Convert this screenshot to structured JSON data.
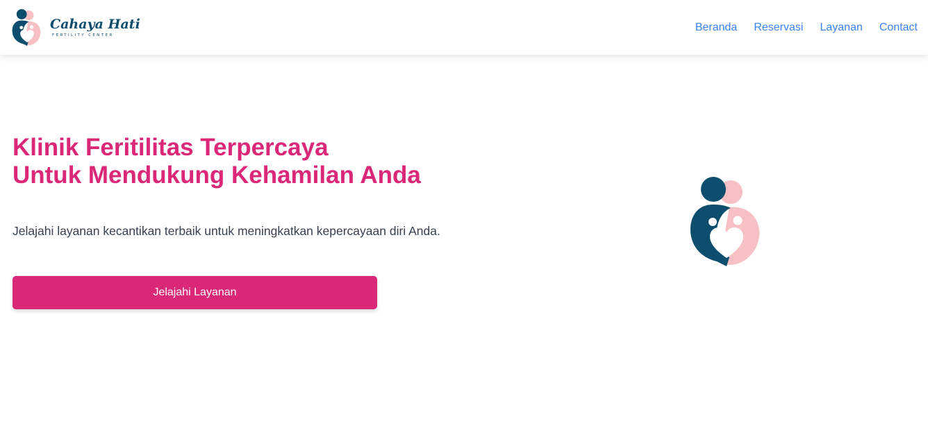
{
  "brand": {
    "name": "Cahaya Hati",
    "subtitle": "FERTILITY CENTER",
    "logo_icon": "family-heart-logo"
  },
  "nav": {
    "items": [
      {
        "label": "Beranda"
      },
      {
        "label": "Reservasi"
      },
      {
        "label": "Layanan"
      },
      {
        "label": "Contact"
      }
    ]
  },
  "hero": {
    "title_line1": "Klinik Feritilitas Terpercaya",
    "title_line2": "Untuk Mendukung Kehamilan Anda",
    "description": "Jelajahi layanan kecantikan terbaik untuk meningkatkan kepercayaan diri Anda.",
    "cta_label": "Jelajahi Layanan",
    "illustration_icon": "family-heart-logo"
  },
  "colors": {
    "accent": "#db2777",
    "nav_link": "#3b82f6",
    "logo_navy": "#0d4d6e",
    "logo_pink": "#f7c0c4"
  }
}
